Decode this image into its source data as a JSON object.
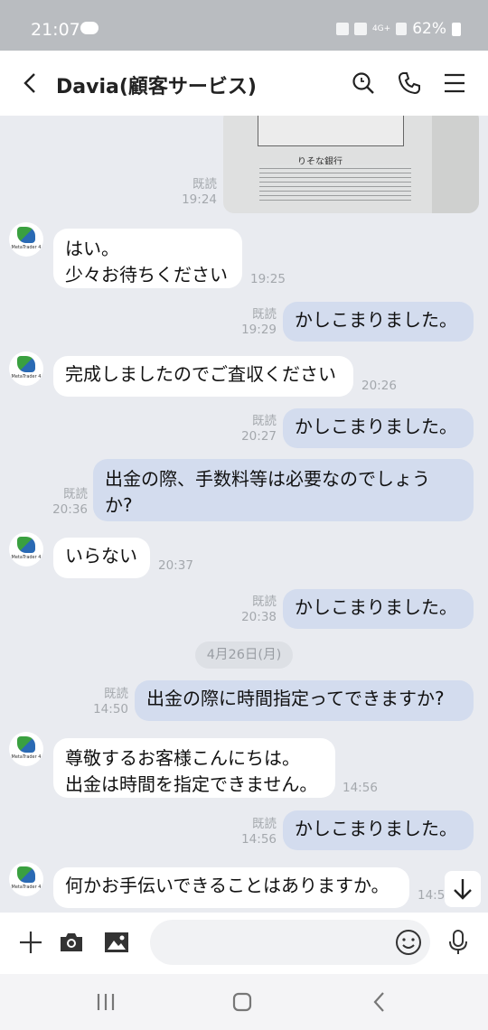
{
  "status_bar": {
    "time": "21:07",
    "network": "4G+",
    "battery": "62%"
  },
  "header": {
    "title": "Davia(顧客サービス)"
  },
  "messages": [
    {
      "dir": "out",
      "kind": "image",
      "read": "既読",
      "time": "19:24"
    },
    {
      "dir": "in",
      "lines": [
        "はい。",
        "少々お待ちください"
      ],
      "time": "19:25"
    },
    {
      "dir": "out",
      "lines": [
        "かしこまりました。"
      ],
      "read": "既読",
      "time": "19:29"
    },
    {
      "dir": "in",
      "lines": [
        "完成しましたのでご査収ください"
      ],
      "time": "20:26"
    },
    {
      "dir": "out",
      "lines": [
        "かしこまりました。"
      ],
      "read": "既読",
      "time": "20:27"
    },
    {
      "dir": "out",
      "lines": [
        "出金の際、手数料等は必要なのでしょう",
        "か?"
      ],
      "read": "既読",
      "time": "20:36"
    },
    {
      "dir": "in",
      "lines": [
        "いらない"
      ],
      "time": "20:37"
    },
    {
      "dir": "out",
      "lines": [
        "かしこまりました。"
      ],
      "read": "既読",
      "time": "20:38"
    },
    {
      "dir": "date",
      "label": "4月26日(月)"
    },
    {
      "dir": "out",
      "lines": [
        "出金の際に時間指定ってできますか?"
      ],
      "read": "既読",
      "time": "14:50"
    },
    {
      "dir": "in",
      "lines": [
        "尊敬するお客様こんにちは。",
        "出金は時間を指定できません。"
      ],
      "time": "14:56"
    },
    {
      "dir": "out",
      "lines": [
        "かしこまりました。"
      ],
      "read": "既読",
      "time": "14:56"
    },
    {
      "dir": "in",
      "lines": [
        "何かお手伝いできることはありますか。"
      ],
      "time": "14:57"
    }
  ],
  "avatar": {
    "caption": "MetaTrader 4"
  },
  "photo": {
    "caption": "りそな銀行"
  },
  "input": {
    "placeholder": "",
    "value": ""
  }
}
